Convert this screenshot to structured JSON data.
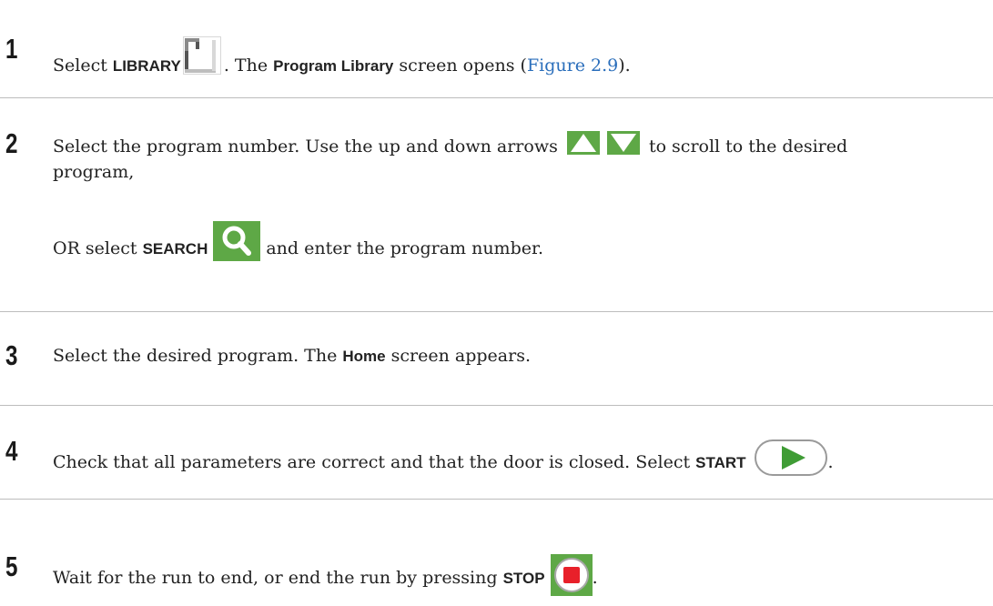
{
  "steps": [
    {
      "number": "1",
      "text_a": "Select ",
      "kw_library": "LIBRARY",
      "text_b": ". The ",
      "kw_program_library": "Program Library",
      "text_c": " screen opens (",
      "link_figure": "Figure 2.9",
      "text_d": ")."
    },
    {
      "number": "2",
      "text_a": "Select the program number. Use the up and down arrows",
      "text_b": "to scroll to the desired",
      "text_c": "program,",
      "text_d": "OR select ",
      "kw_search": "SEARCH",
      "text_e": "and enter the program number."
    },
    {
      "number": "3",
      "text_a": "Select the desired program. The ",
      "kw_home": "Home",
      "text_b": " screen appears."
    },
    {
      "number": "4",
      "text_a": "Check that all parameters are correct and that the door is closed. Select ",
      "kw_start": "START",
      "text_b": "."
    },
    {
      "number": "5",
      "text_a": "Wait for the run to end, or end the run by pressing ",
      "kw_stop": "STOP",
      "text_b": "."
    }
  ],
  "icons": {
    "library": "library-icon",
    "up_arrow": "up-arrow-icon",
    "down_arrow": "down-arrow-icon",
    "search": "search-icon",
    "start": "start-play-icon",
    "stop": "stop-icon"
  },
  "colors": {
    "icon_green": "#5ea846",
    "play_green": "#3f9c35",
    "stop_red": "#e8202a",
    "link_blue": "#2a6ebb",
    "divider": "#bdbdbd"
  }
}
